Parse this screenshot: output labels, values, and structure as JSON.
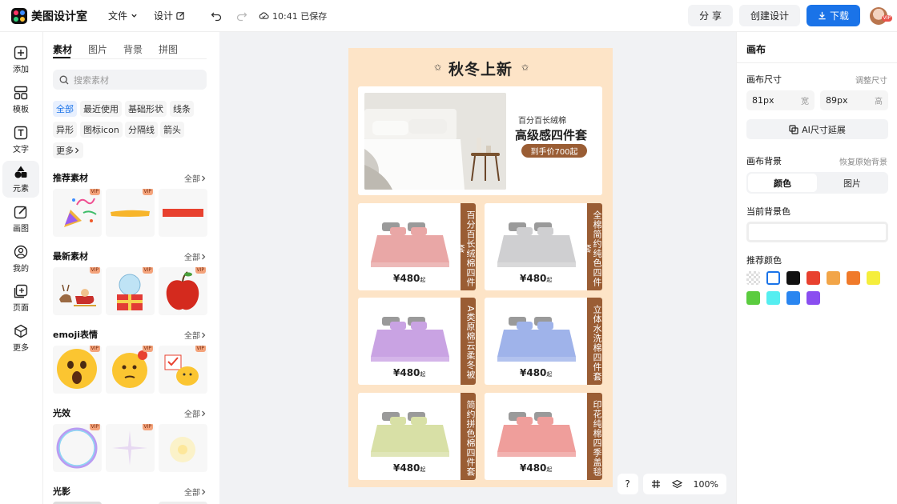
{
  "app": {
    "name": "美图设计室",
    "menu": {
      "file": "文件",
      "design": "设计"
    },
    "saved_status": "10:41 已保存",
    "share": "分 享",
    "create_design": "创建设计",
    "download": "下载",
    "avatar_badge": "VIP"
  },
  "rail": {
    "items": [
      {
        "label": "添加",
        "icon": "add-icon"
      },
      {
        "label": "模板",
        "icon": "template-icon"
      },
      {
        "label": "文字",
        "icon": "text-icon"
      },
      {
        "label": "元素",
        "icon": "element-icon"
      },
      {
        "label": "画图",
        "icon": "draw-icon"
      },
      {
        "label": "我的",
        "icon": "user-icon"
      },
      {
        "label": "页面",
        "icon": "page-icon"
      },
      {
        "label": "更多",
        "icon": "more-icon"
      }
    ]
  },
  "panel": {
    "tabs": [
      "素材",
      "图片",
      "背景",
      "拼图"
    ],
    "search_placeholder": "搜索素材",
    "chips": [
      "全部",
      "最近使用",
      "基础形状",
      "线条",
      "异形",
      "图标icon",
      "分隔线",
      "箭头",
      "更多"
    ],
    "all_label": "全部",
    "vip_tag": "VIP",
    "sections": [
      {
        "title": "推荐素材"
      },
      {
        "title": "最新素材"
      },
      {
        "title": "emoji表情"
      },
      {
        "title": "光效"
      },
      {
        "title": "光影"
      }
    ]
  },
  "poster": {
    "title": "秋冬上新",
    "hero": {
      "subtitle": "百分百长绒棉",
      "headline": "高级感四件套",
      "price_tag": "到手价700起"
    },
    "cards": [
      {
        "label": "百分百长绒棉四件套",
        "price": "¥480",
        "suffix": "起",
        "color": "#e9a7a6"
      },
      {
        "label": "全棉简约纯色四件套",
        "price": "¥480",
        "suffix": "起",
        "color": "#cfcfd1"
      },
      {
        "label": "A类原棉云柔冬被",
        "price": "¥480",
        "suffix": "起",
        "color": "#c9a3e3"
      },
      {
        "label": "立体水洗棉四件套",
        "price": "¥480",
        "suffix": "起",
        "color": "#9fb3ea"
      },
      {
        "label": "简约拼色棉四件套",
        "price": "¥480",
        "suffix": "起",
        "color": "#d8e0a6"
      },
      {
        "label": "印花纯棉四季盖毯",
        "price": "¥480",
        "suffix": "起",
        "color": "#ef9e9b"
      }
    ]
  },
  "canvas_controls": {
    "help": "?",
    "zoom": "100%"
  },
  "right_panel": {
    "title": "画布",
    "size_label": "画布尺寸",
    "size_link": "调整尺寸",
    "width_value": "81px",
    "width_unit": "宽",
    "height_value": "89px",
    "height_unit": "高",
    "ai_button": "AI尺寸延展",
    "bg_label": "画布背景",
    "bg_reset": "恢复原始背景",
    "seg_color": "颜色",
    "seg_image": "图片",
    "current_bg_label": "当前背景色",
    "recommend_label": "推荐颜色",
    "swatches": [
      "transparent",
      "#ffffff",
      "#111111",
      "#e8412f",
      "#f2a548",
      "#f07a2a",
      "#f5ee3c",
      "#5bcc3f",
      "#55eef0",
      "#2a86f0",
      "#8a4ef0"
    ]
  }
}
